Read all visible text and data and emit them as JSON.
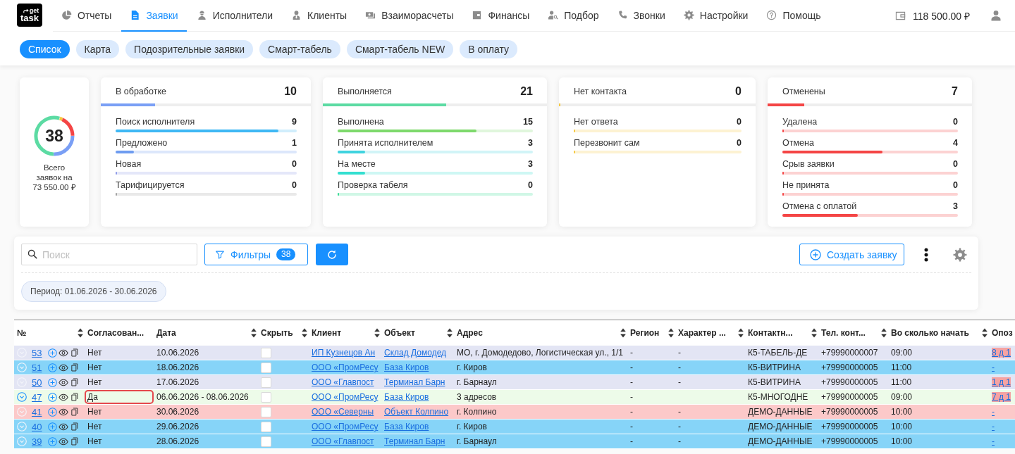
{
  "logo": {
    "top": "get",
    "bottom": "task"
  },
  "nav": [
    {
      "label": "Отчеты",
      "selected": false
    },
    {
      "label": "Заявки",
      "selected": true
    },
    {
      "label": "Исполнители",
      "selected": false
    },
    {
      "label": "Клиенты",
      "selected": false
    },
    {
      "label": "Взаиморасчеты",
      "selected": false
    },
    {
      "label": "Финансы",
      "selected": false
    },
    {
      "label": "Подбор",
      "selected": false
    },
    {
      "label": "Звонки",
      "selected": false
    },
    {
      "label": "Настройки",
      "selected": false
    },
    {
      "label": "Помощь",
      "selected": false
    }
  ],
  "balance": "118 500.00 ₽",
  "subtabs": [
    {
      "label": "Список",
      "selected": true
    },
    {
      "label": "Карта",
      "selected": false
    },
    {
      "label": "Подозрительные заявки",
      "selected": false
    },
    {
      "label": "Смарт-табель",
      "selected": false
    },
    {
      "label": "Смарт-табель NEW",
      "selected": false
    },
    {
      "label": "В оплату",
      "selected": false
    }
  ],
  "summary": {
    "total": "38",
    "caption": "Всего заявок на",
    "amount": "73 550.00 ₽"
  },
  "groups": [
    {
      "title": "В обработке",
      "count": "10",
      "level": 0.26,
      "color": "#7a9ff5",
      "rows": [
        {
          "label": "Поиск исполнителя",
          "count": "9",
          "level": 0.9,
          "color": "#3fb8f4"
        },
        {
          "label": "Предложено",
          "count": "1",
          "level": 0.1,
          "color": "#6e9cf0"
        },
        {
          "label": "Новая",
          "count": "0",
          "level": 0,
          "color": "#8f9be8"
        },
        {
          "label": "Тарифицируется",
          "count": "0",
          "level": 0,
          "color": "#a3a3a3"
        }
      ]
    },
    {
      "title": "Выполняется",
      "count": "21",
      "level": 0.55,
      "color": "#5cdba3",
      "rows": [
        {
          "label": "Выполнена",
          "count": "15",
          "level": 0.71,
          "color": "#7ed96c"
        },
        {
          "label": "Принята исполнителем",
          "count": "3",
          "level": 0.14,
          "color": "#3fd3df"
        },
        {
          "label": "На месте",
          "count": "3",
          "level": 0.14,
          "color": "#33dfd0"
        },
        {
          "label": "Проверка табеля",
          "count": "0",
          "level": 0,
          "color": "#3ddc97"
        }
      ]
    },
    {
      "title": "Нет контакта",
      "count": "0",
      "level": 0,
      "color": "#f5c842",
      "rows": [
        {
          "label": "Нет ответа",
          "count": "0",
          "level": 0,
          "color": "#f5c842"
        },
        {
          "label": "Перезвонит сам",
          "count": "0",
          "level": 0,
          "color": "#f5c842"
        }
      ]
    },
    {
      "title": "Отменены",
      "count": "7",
      "level": 0.18,
      "color": "#f44545",
      "rows": [
        {
          "label": "Удалена",
          "count": "0",
          "level": 0,
          "color": "#f44545"
        },
        {
          "label": "Отмена",
          "count": "4",
          "level": 0.57,
          "color": "#f44545"
        },
        {
          "label": "Срыв заявки",
          "count": "0",
          "level": 0,
          "color": "#f44545"
        },
        {
          "label": "Не принята",
          "count": "0",
          "level": 0,
          "color": "#f44545"
        },
        {
          "label": "Отмена с оплатой",
          "count": "3",
          "level": 0.43,
          "color": "#f44545"
        }
      ]
    }
  ],
  "toolbar": {
    "search": {
      "placeholder": "Поиск"
    },
    "filter_label": "Фильтры",
    "filter_count": "38",
    "create_label": "Создать заявку",
    "period": "Период: 01.06.2026 - 30.06.2026"
  },
  "table": {
    "columns": [
      {
        "label": "№",
        "sortable": true
      },
      {
        "label": "Согласован...",
        "sortable": false
      },
      {
        "label": "Дата",
        "sortable": true
      },
      {
        "label": "Скрыть",
        "sortable": true
      },
      {
        "label": "Клиент",
        "sortable": true
      },
      {
        "label": "Объект",
        "sortable": true
      },
      {
        "label": "Адрес",
        "sortable": true
      },
      {
        "label": "Регион",
        "sortable": true
      },
      {
        "label": "Характер ...",
        "sortable": true
      },
      {
        "label": "Контактн...",
        "sortable": true
      },
      {
        "label": "Тел. конт...",
        "sortable": true
      },
      {
        "label": "Во сколько начать",
        "sortable": true
      },
      {
        "label": "Опоз",
        "sortable": false
      }
    ],
    "rows": [
      {
        "number": "53",
        "expandable": false,
        "agreed": "Нет",
        "flagged": false,
        "date": "10.06.2026",
        "hidden": false,
        "client": "ИП Кузнецов Ан",
        "object": "Склад Домодед",
        "address": "МО, г. Домодедово, Логистическая ул., 1/1",
        "region": "-",
        "character": "-",
        "contact": "К5-ТАБЕЛЬ-ДЕ",
        "phone": "+79990000007",
        "start_time": "09:00",
        "column_13": "8 д 1",
        "late": true,
        "color": "#e3e5f4"
      },
      {
        "number": "51",
        "expandable": false,
        "agreed": "Нет",
        "flagged": false,
        "date": "18.06.2026",
        "hidden": false,
        "client": "ООО «ПромРесу",
        "object": "База Киров",
        "address": "г. Киров",
        "region": "-",
        "character": "-",
        "contact": "К5-ВИТРИНА",
        "phone": "+79990000005",
        "start_time": "11:00",
        "column_13": "-",
        "late": false,
        "color": "#86d4f8"
      },
      {
        "number": "50",
        "expandable": false,
        "agreed": "Нет",
        "flagged": false,
        "date": "17.06.2026",
        "hidden": false,
        "client": "ООО «Главпост",
        "object": "Терминал Барн",
        "address": "г. Барнаул",
        "region": "-",
        "character": "-",
        "contact": "К5-ВИТРИНА",
        "phone": "+79990000005",
        "start_time": "11:00",
        "column_13": "1 д 1",
        "late": true,
        "color": "#e3e5f4"
      },
      {
        "number": "47",
        "expandable": true,
        "agreed": "Да",
        "flagged": true,
        "date": "06.06.2026 - 08.06.2026",
        "hidden": false,
        "client": "ООО «ПромРесу",
        "object": "База Киров",
        "address": "3 адресов",
        "region": "-",
        "contact": "К5-МНОГОДНЕ",
        "phone": "+79990000005",
        "start_time": "09:00",
        "column_13": "7 д 1",
        "late": true,
        "color": "#edfbe9"
      },
      {
        "number": "41",
        "expandable": false,
        "agreed": "Нет",
        "flagged": false,
        "date": "30.06.2026",
        "hidden": false,
        "client": "ООО «Северны",
        "object": "Объект Колпино",
        "address": "г. Колпино",
        "region": "-",
        "character": "-",
        "contact": "ДЕМО-ДАННЫЕ",
        "phone": "+79990000005",
        "start_time": "10:00",
        "column_13": "-",
        "late": false,
        "color": "#fcc9c9"
      },
      {
        "number": "40",
        "expandable": false,
        "agreed": "Нет",
        "flagged": false,
        "date": "29.06.2026",
        "hidden": false,
        "client": "ООО «ПромРесу",
        "object": "База Киров",
        "address": "г. Киров",
        "region": "-",
        "character": "-",
        "contact": "ДЕМО-ДАННЫЕ",
        "phone": "+79990000005",
        "start_time": "10:00",
        "column_13": "-",
        "late": false,
        "color": "#86d4f8"
      },
      {
        "number": "39",
        "expandable": false,
        "agreed": "Нет",
        "flagged": false,
        "date": "28.06.2026",
        "hidden": false,
        "client": "ООО «Главпост",
        "object": "Терминал Барн",
        "address": "г. Барнаул",
        "region": "-",
        "character": "-",
        "contact": "ДЕМО-ДАННЫЕ",
        "phone": "+79990000005",
        "start_time": "10:00",
        "column_13": "-",
        "late": false,
        "color": "#86d4f8"
      }
    ]
  }
}
